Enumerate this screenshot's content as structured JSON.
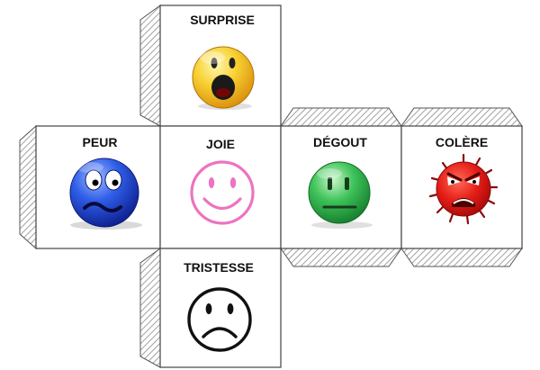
{
  "diagram": {
    "faces": [
      {
        "id": "surprise",
        "label": "SURPRISE"
      },
      {
        "id": "peur",
        "label": "PEUR"
      },
      {
        "id": "joie",
        "label": "JOIE"
      },
      {
        "id": "degout",
        "label": "DÉGOUT"
      },
      {
        "id": "colere",
        "label": "COLÈRE"
      },
      {
        "id": "tristesse",
        "label": "TRISTESSE"
      }
    ],
    "icons": {
      "surprise": "surprised-face-icon",
      "peur": "fear-face-icon",
      "joie": "happy-face-icon",
      "degout": "disgust-face-icon",
      "colere": "angry-face-icon",
      "tristesse": "sad-face-icon"
    },
    "colors": {
      "surprise": "#f6c21a",
      "peur": "#2c58e0",
      "joie": "#ec74c0",
      "degout": "#2fb44a",
      "colere": "#e41c16",
      "tristesse": "#111111",
      "outline": "#444444",
      "hatch": "#888888"
    }
  }
}
